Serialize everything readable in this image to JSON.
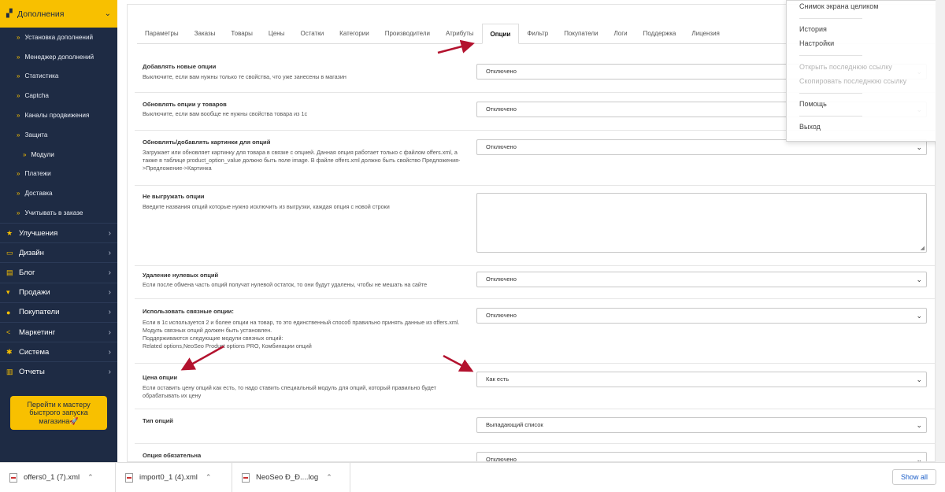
{
  "sidebar": {
    "top": {
      "label": "Дополнения"
    },
    "sub_items": [
      {
        "label": "Установка дополнений"
      },
      {
        "label": "Менеджер дополнений"
      },
      {
        "label": "Статистика"
      },
      {
        "label": "Captcha"
      },
      {
        "label": "Каналы продвижения"
      },
      {
        "label": "Защита"
      },
      {
        "label": "Модули"
      },
      {
        "label": "Платежи"
      },
      {
        "label": "Доставка"
      },
      {
        "label": "Учитывать в заказе"
      }
    ],
    "main_items": [
      {
        "label": "Улучшения",
        "icon": "star-icon"
      },
      {
        "label": "Дизайн",
        "icon": "monitor-icon"
      },
      {
        "label": "Блог",
        "icon": "book-icon"
      },
      {
        "label": "Продажи",
        "icon": "cart-icon"
      },
      {
        "label": "Покупатели",
        "icon": "user-icon"
      },
      {
        "label": "Маркетинг",
        "icon": "share-icon"
      },
      {
        "label": "Система",
        "icon": "gear-icon"
      },
      {
        "label": "Отчеты",
        "icon": "chart-icon"
      }
    ],
    "wizard": {
      "label": "Перейти к мастеру быстрого запуска магазина🚀"
    }
  },
  "tabs": [
    {
      "label": "Параметры"
    },
    {
      "label": "Заказы"
    },
    {
      "label": "Товары"
    },
    {
      "label": "Цены"
    },
    {
      "label": "Остатки"
    },
    {
      "label": "Категории"
    },
    {
      "label": "Производители"
    },
    {
      "label": "Атрибуты"
    },
    {
      "label": "Опции"
    },
    {
      "label": "Фильтр"
    },
    {
      "label": "Покупатели"
    },
    {
      "label": "Логи"
    },
    {
      "label": "Поддержка"
    },
    {
      "label": "Лицензия"
    }
  ],
  "active_tab": "Опции",
  "rows": [
    {
      "title": "Добавлять новые опции",
      "desc": "Выключите, если вам нужны только те свойства, что уже занесены в магазин",
      "value": "Отключено"
    },
    {
      "title": "Обновлять опции у товаров",
      "desc": "Выключите, если вам вообще не нужны свойства товара из 1с",
      "value": "Отключено"
    },
    {
      "title": "Обновлять/добавлять картинки для опций",
      "desc": "Загружает или обновляет картинку для товара в связке с опцией. Данная опция работает только с файлом offers.xml, а также в таблице product_option_value должно быть поле image. В файле offers.xml должно быть свойство Предложения->Предложение->Картинка",
      "value": "Отключено"
    },
    {
      "title": "Не выгружать опции",
      "desc": "Введите названия опций которые нужно исключить из выгрузки, каждая опция с новой строки",
      "value": ""
    },
    {
      "title": "Удаление нулевых опций",
      "desc": "Если после обмена часть опций получат нулевой остаток, то они будут удалены, чтобы не мешать на сайте",
      "value": "Отключено"
    },
    {
      "title": "Использовать связные опции:",
      "desc": "Если в 1с используется 2 и более опции на товар, то это единственный способ правильно принять данные из offers.xml. Модуль связных опций должен быть установлен.\nПоддерживаются следующие модули связных опций:\nRelated options,NeoSeo Product options PRO, Комбинации опций",
      "value": "Отключено"
    },
    {
      "title": "Цена опции",
      "desc": "Если оставить цену опций как есть, то надо ставить специальный модуль для опций, который правильно будет обрабатывать их цену",
      "value": "Как есть"
    },
    {
      "title": "Тип опций",
      "desc": "",
      "value": "Выпадающий список"
    },
    {
      "title": "Опция обязательна",
      "desc": "",
      "value": "Отключено"
    }
  ],
  "context_menu": {
    "items": [
      {
        "label": "Снимок экрана целиком",
        "disabled": false
      },
      {
        "label": "История",
        "disabled": false
      },
      {
        "label": "Настройки",
        "disabled": false
      },
      {
        "label": "Открыть последнюю ссылку",
        "disabled": true
      },
      {
        "label": "Скопировать последнюю ссылку",
        "disabled": true
      },
      {
        "label": "Помощь",
        "disabled": false
      },
      {
        "label": "Выход",
        "disabled": false
      }
    ]
  },
  "downloads": [
    {
      "name": "offers0_1 (7).xml"
    },
    {
      "name": "import0_1 (4).xml"
    },
    {
      "name": "NeoSeo Ð_Ð....log"
    }
  ],
  "show_all": "Show all",
  "colors": {
    "accent": "#f8c000",
    "sidebar": "#1e2b44",
    "arrow": "#b3122e"
  }
}
